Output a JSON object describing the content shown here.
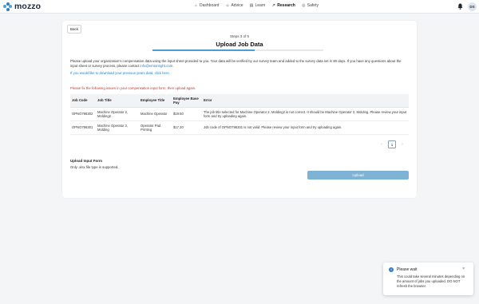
{
  "brand": {
    "name": "mozzo",
    "accent": "#2f7fc1"
  },
  "nav": [
    {
      "label": "Dashboard",
      "icon": "home-icon"
    },
    {
      "label": "Advice",
      "icon": "people-icon"
    },
    {
      "label": "Learn",
      "icon": "book-icon"
    },
    {
      "label": "Research",
      "icon": "chart-icon",
      "active": true
    },
    {
      "label": "Safety",
      "icon": "shield-icon"
    }
  ],
  "user": {
    "initials": "DS"
  },
  "page": {
    "back_label": "Back",
    "steps": "Steps 3 of 5",
    "title": "Upload Job Data",
    "progress": 0.6,
    "intro": "Please upload your organization's compensation data using the input sheet provided to you. Your data will be verified by our survey team and added to the survey data set in 90 days. If you have any questions about the input sheet or survey process, please contact ",
    "contact_email": "info@emtonright.com",
    "intro_end": ".",
    "download_prefix": "If you would like to download your previous years data, ",
    "download_link": "click here",
    "download_suffix": ".",
    "fix_note": "Please fix the following issues in your compensation input form, then upload again."
  },
  "table": {
    "headers": [
      "Job Code",
      "Job Title",
      "Employee Title",
      "Employee Base Pay",
      "Error"
    ],
    "rows": [
      [
        "OPNO796302",
        "Machine Operator 2, Molding2",
        "Machine Operator",
        "$19.50",
        "The job title selected for Machine Operator 2, Molding2 is not correct. It should be Machine Operator 2, Molding. Please review your input form and try uploading again."
      ],
      [
        "OPNO796301",
        "Machine Operator 2, Molding",
        "Operator Pad Printing",
        "$17.20",
        "Job code of OPNO796301 is not valid. Please review your input form and try uploading again."
      ]
    ]
  },
  "pagination": {
    "current": "1",
    "prev": "‹",
    "next": "›"
  },
  "upload": {
    "label": "Upload Input Form",
    "hint": "Only .xlsx file type is supported.",
    "button": "Upload"
  },
  "toast": {
    "title": "Please wait",
    "body": "This could take several minutes depending on the amount of jobs you uploaded. DO NOT refresh the browser.",
    "close": "×",
    "icon": "info-icon"
  }
}
